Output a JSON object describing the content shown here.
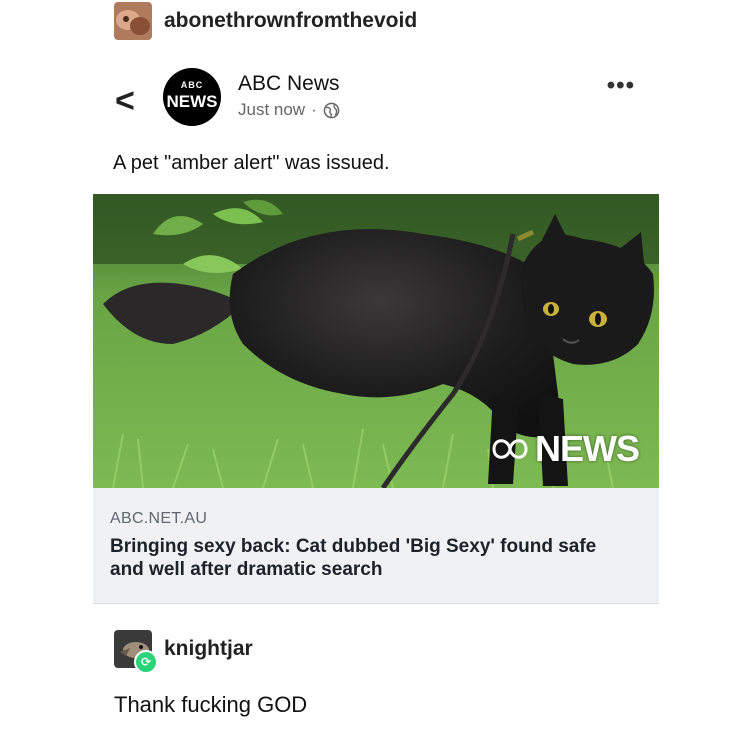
{
  "op": {
    "username": "abonethrownfromthevoid"
  },
  "post": {
    "source_name": "ABC News",
    "source_logo": {
      "top": "ABC",
      "word": "NEWS"
    },
    "time": "Just now",
    "separator": "·",
    "globe_icon": "globe-icon",
    "back_icon": "chevron-left-icon",
    "more_icon": "ellipsis-icon",
    "back_glyph": "<",
    "more_glyph": "•••",
    "text": "A pet \"amber alert\" was issued.",
    "link": {
      "domain": "ABC.NET.AU",
      "headline": "Bringing sexy back: Cat dubbed 'Big Sexy' found safe and well after dramatic search",
      "image_watermark": "NEWS"
    }
  },
  "reblogger": {
    "username": "knightjar",
    "comment": "Thank fucking GOD"
  },
  "colors": {
    "reblog_badge": "#2bd47a",
    "link_bg": "#f0f1f4",
    "grass": "#5f9b3a"
  }
}
